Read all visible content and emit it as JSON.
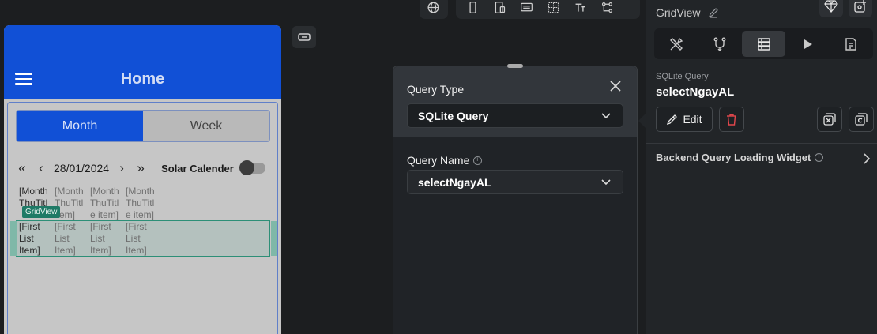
{
  "toolbar": {
    "icons": [
      "globe-icon",
      "phone-icon",
      "tablet-icon",
      "keyboard-icon",
      "grid-icon",
      "text-size-icon",
      "tree-icon"
    ]
  },
  "phone": {
    "appbar_title": "Home",
    "segment": {
      "active": "Month",
      "inactive": "Week"
    },
    "date": "28/01/2024",
    "solar_label": "Solar Calender",
    "grid_badge": "GridView",
    "header_cells": [
      "[Month\nThuTitl\n",
      "[Month\nThuTitl\nitem]",
      "[Month\nThuTitl\ne item]",
      "[Month\nThuTitl\ne item]"
    ],
    "item_cells": [
      "[First\nList\nItem]",
      "[First\nList\nItem]",
      "[First\nList\nItem]",
      "[First\nList\nItem]"
    ]
  },
  "query_panel": {
    "type_label": "Query Type",
    "type_value": "SQLite Query",
    "name_label": "Query Name",
    "name_value": "selectNgayAL"
  },
  "props": {
    "title": "GridView",
    "query_sub": "SQLite Query",
    "query_name": "selectNgayAL",
    "edit_label": "Edit",
    "backend_label": "Backend Query Loading Widget"
  },
  "colors": {
    "brand_blue": "#1150d6",
    "panel_bg": "#222528",
    "delete_red": "#e0474c",
    "grid_select": "#2c8f77"
  }
}
